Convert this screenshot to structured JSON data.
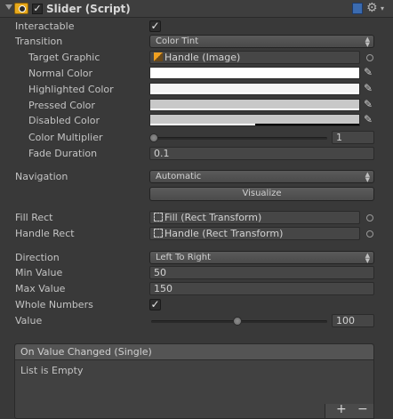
{
  "header": {
    "title": "Slider (Script)",
    "enabled_check": "✓",
    "gear": "⚙",
    "gear_drop": "▾"
  },
  "fields": {
    "interactable": {
      "label": "Interactable",
      "check": "✓"
    },
    "transition": {
      "label": "Transition",
      "value": "Color Tint"
    },
    "target_graphic": {
      "label": "Target Graphic",
      "value": "Handle (Image)"
    },
    "normal_color": {
      "label": "Normal Color",
      "color": "#ffffff",
      "alpha": 1.0
    },
    "highlighted_color": {
      "label": "Highlighted Color",
      "color": "#f5f5f5",
      "alpha": 1.0
    },
    "pressed_color": {
      "label": "Pressed Color",
      "color": "#c8c8c8",
      "alpha": 1.0
    },
    "disabled_color": {
      "label": "Disabled Color",
      "color": "#c8c8c8",
      "alpha": 0.5
    },
    "color_multiplier": {
      "label": "Color Multiplier",
      "value": "1",
      "fraction": 0.0
    },
    "fade_duration": {
      "label": "Fade Duration",
      "value": "0.1"
    },
    "navigation": {
      "label": "Navigation",
      "value": "Automatic"
    },
    "visualize": {
      "label": "Visualize"
    },
    "fill_rect": {
      "label": "Fill Rect",
      "value": "Fill (Rect Transform)"
    },
    "handle_rect": {
      "label": "Handle Rect",
      "value": "Handle (Rect Transform)"
    },
    "direction": {
      "label": "Direction",
      "value": "Left To Right"
    },
    "min_value": {
      "label": "Min Value",
      "value": "50"
    },
    "max_value": {
      "label": "Max Value",
      "value": "150"
    },
    "whole_numbers": {
      "label": "Whole Numbers",
      "check": "✓"
    },
    "value": {
      "label": "Value",
      "value": "100",
      "fraction": 0.5
    }
  },
  "event": {
    "title": "On Value Changed (Single)",
    "empty": "List is Empty",
    "add": "+",
    "remove": "−"
  },
  "icons": {
    "eyedropper": "⁄",
    "dropdown_arrows": "▲▼",
    "rect_transform": "⛶"
  },
  "colors": {
    "background": "#393939",
    "text": "#c4c4c4",
    "script_icon": "#e7a91b",
    "book_icon": "#3b6bb0"
  }
}
